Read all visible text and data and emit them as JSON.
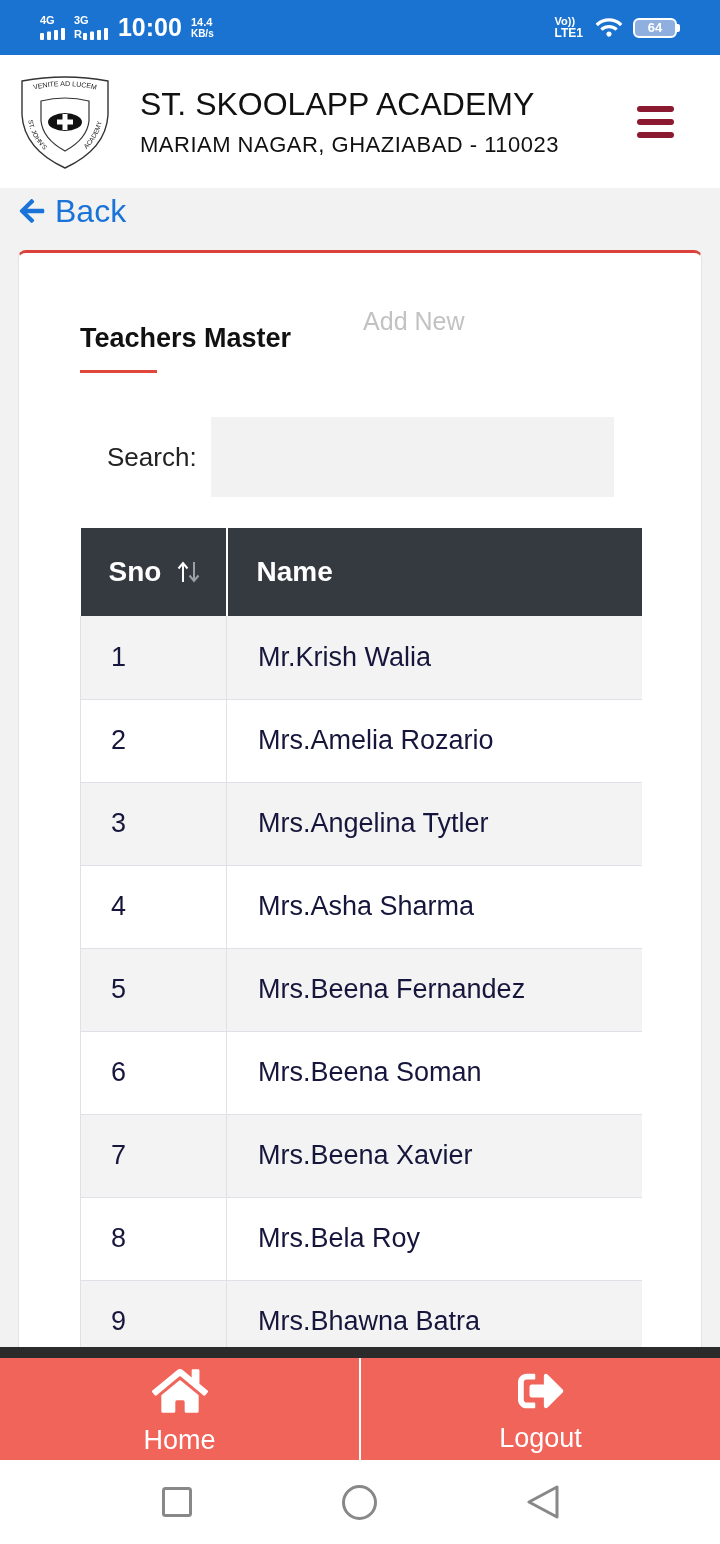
{
  "status_bar": {
    "sim_1": {
      "network": "4G"
    },
    "sim_2": {
      "network": "3G",
      "roaming": "R"
    },
    "time": "10:00",
    "data_speed": {
      "value": "14.4",
      "unit": "KB/s"
    },
    "volte": {
      "top": "Vo))",
      "bottom": "LTE1"
    },
    "battery": "64"
  },
  "header": {
    "logo": {
      "motto": "VENITE AD LUCEM",
      "left_text": "ST. JOHN'S",
      "right_text": "ACADEMY"
    },
    "title": "ST. SKOOLAPP ACADEMY",
    "address": "MARIAM NAGAR, GHAZIABAD - 110023"
  },
  "back_link": "Back",
  "card": {
    "title": "Teachers Master",
    "add_new_button": "Add New",
    "search": {
      "label": "Search:"
    },
    "table": {
      "columns": [
        {
          "label": "Sno",
          "sortable": true
        },
        {
          "label": "Name",
          "sortable": false
        }
      ],
      "rows": [
        {
          "sno": "1",
          "name": "Mr.Krish Walia"
        },
        {
          "sno": "2",
          "name": "Mrs.Amelia Rozario"
        },
        {
          "sno": "3",
          "name": "Mrs.Angelina Tytler"
        },
        {
          "sno": "4",
          "name": "Mrs.Asha Sharma"
        },
        {
          "sno": "5",
          "name": "Mrs.Beena Fernandez"
        },
        {
          "sno": "6",
          "name": "Mrs.Beena Soman"
        },
        {
          "sno": "7",
          "name": "Mrs.Beena Xavier"
        },
        {
          "sno": "8",
          "name": "Mrs.Bela Roy"
        },
        {
          "sno": "9",
          "name": "Mrs.Bhawna Batra"
        }
      ]
    }
  },
  "bottom_nav": [
    {
      "kind": "home",
      "label": "Home"
    },
    {
      "kind": "logout",
      "label": "Logout"
    }
  ]
}
